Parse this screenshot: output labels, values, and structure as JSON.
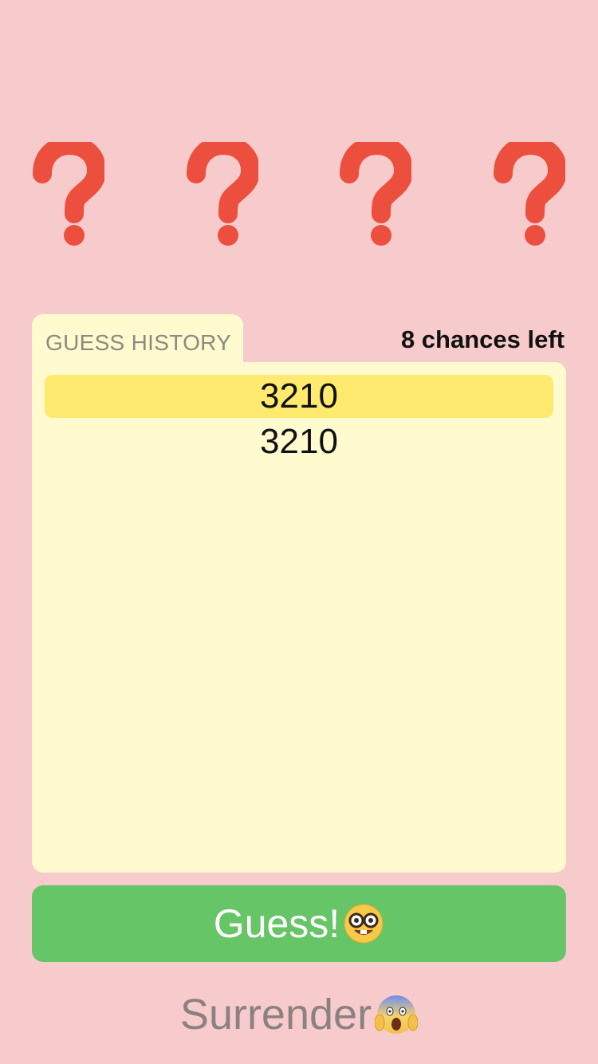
{
  "slots": [
    {
      "icon": "question-mark-icon",
      "color": "#ec4f3e"
    },
    {
      "icon": "question-mark-icon",
      "color": "#ec4f3e"
    },
    {
      "icon": "question-mark-icon",
      "color": "#ec4f3e"
    },
    {
      "icon": "question-mark-icon",
      "color": "#ec4f3e"
    }
  ],
  "history": {
    "tab_label": "GUESS HISTORY",
    "chances_label": "8 chances left",
    "entries": [
      "3210",
      "3210"
    ]
  },
  "actions": {
    "guess_label": "Guess!",
    "guess_icon": "nerd-face-icon",
    "surrender_label": "Surrender",
    "surrender_icon": "screaming-face-icon"
  },
  "colors": {
    "background": "#f7cbcb",
    "panel": "#fffbcf",
    "highlight": "#fdea6f",
    "guess_button": "#66c566",
    "question_mark": "#ec4f3e"
  }
}
